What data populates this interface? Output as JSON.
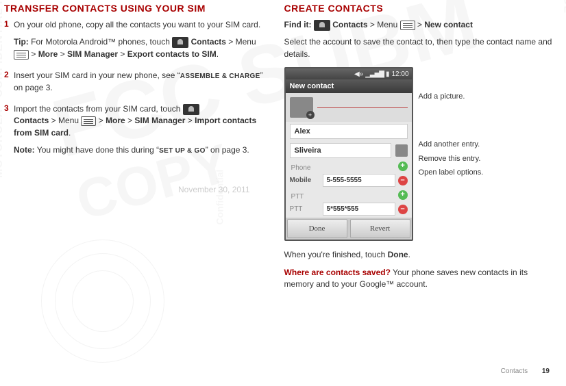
{
  "left": {
    "heading": "TRANSFER CONTACTS USING YOUR SIM",
    "step1_num": "1",
    "step1_text": "On your old phone, copy all the contacts you want to your SIM card.",
    "tip_label": "Tip:",
    "tip_text": " For Motorola Android™ phones, touch ",
    "tip_path_1": " Contacts",
    "tip_gt1": " > Menu ",
    "tip_more": "More",
    "tip_gt2": " > ",
    "tip_sim_mgr": "SIM Manager",
    "tip_gt3": " > ",
    "tip_export": "Export contacts to SIM",
    "step2_num": "2",
    "step2_a": "Insert your SIM card in your new phone, see “",
    "step2_ref": "ASSEMBLE & CHARGE",
    "step2_b": "” on page 3.",
    "step3_num": "3",
    "step3_a": "Import the contacts from your SIM card, touch ",
    "step3_contacts": "Contacts",
    "step3_menu": " > Menu ",
    "step3_more": "More",
    "step3_gt": " >  ",
    "step3_sim_mgr": "SIM Manager",
    "step3_gt2": " > ",
    "step3_import": "Import contacts from SIM card",
    "note_label": "Note:",
    "note_a": " You might have done this during “",
    "note_ref": "SET UP & GO",
    "note_b": "” on page 3."
  },
  "right": {
    "heading": "CREATE CONTACTS",
    "findit_label": "Find it:",
    "findit_contacts": " Contacts",
    "findit_menu": " > Menu ",
    "findit_gt": " > ",
    "findit_new": "New contact",
    "intro": "Select the account to save the contact to, then type the contact name and details.",
    "finished_a": "When you're finished, touch ",
    "finished_done": "Done",
    "finished_b": ".",
    "saved_q": "Where are contacts saved?",
    "saved_text": " Your phone saves new contacts in its memory and to your Google™ account."
  },
  "phone": {
    "time": "12:00",
    "title": "New contact",
    "first": "Alex",
    "last": "Sliveira",
    "section_phone": "Phone",
    "mobile_label": "Mobile",
    "mobile_val": "5-555-5555",
    "section_ptt": "PTT",
    "ptt_label": "PTT",
    "ptt_val": "5*555*555",
    "btn_done": "Done",
    "btn_revert": "Revert"
  },
  "callouts": {
    "pic": "Add a picture.",
    "add": "Add another entry.",
    "remove": "Remove this entry.",
    "labels": "Open label options."
  },
  "footer": {
    "section": "Contacts",
    "page": "19"
  },
  "watermark": {
    "date": "November 30, 2011"
  }
}
